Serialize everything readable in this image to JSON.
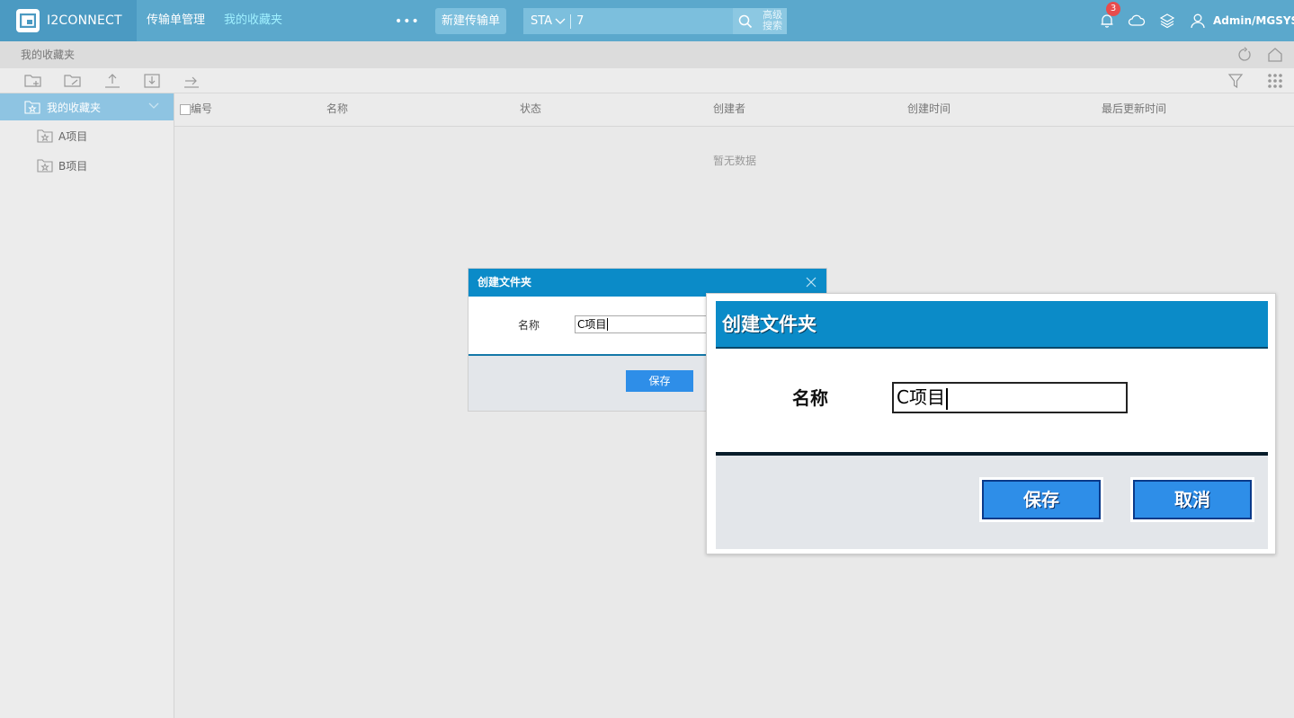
{
  "app": {
    "logo_text": "I2CONNECT",
    "logo_mark": "CN"
  },
  "nav": {
    "items": [
      "传输单管理",
      "我的收藏夹"
    ],
    "more": "•••",
    "new_button": "新建传输单"
  },
  "search": {
    "type": "STA",
    "value": "7",
    "advanced_line1": "高级",
    "advanced_line2": "搜索"
  },
  "header": {
    "notification_count": "3",
    "user": "Admin/MGSYS"
  },
  "breadcrumb": {
    "text": "我的收藏夹"
  },
  "sidebar": {
    "root": "我的收藏夹",
    "items": [
      "A项目",
      "B项目"
    ]
  },
  "table": {
    "columns": [
      "编号",
      "名称",
      "状态",
      "创建者",
      "创建时间",
      "最后更新时间"
    ],
    "empty_text": "暂无数据"
  },
  "dialog": {
    "title": "创建文件夹",
    "name_label": "名称",
    "name_value": "C项目",
    "save_label": "保存"
  },
  "zoom": {
    "title": "创建文件夹",
    "name_label": "名称",
    "name_value": "C项目",
    "save_label": "保存",
    "cancel_label": "取消"
  },
  "colors": {
    "topbar": "#5ba8cc",
    "dialog_header": "#0b8bc8",
    "button": "#2e8ee8",
    "sidebar_active": "#8ec4e2"
  }
}
